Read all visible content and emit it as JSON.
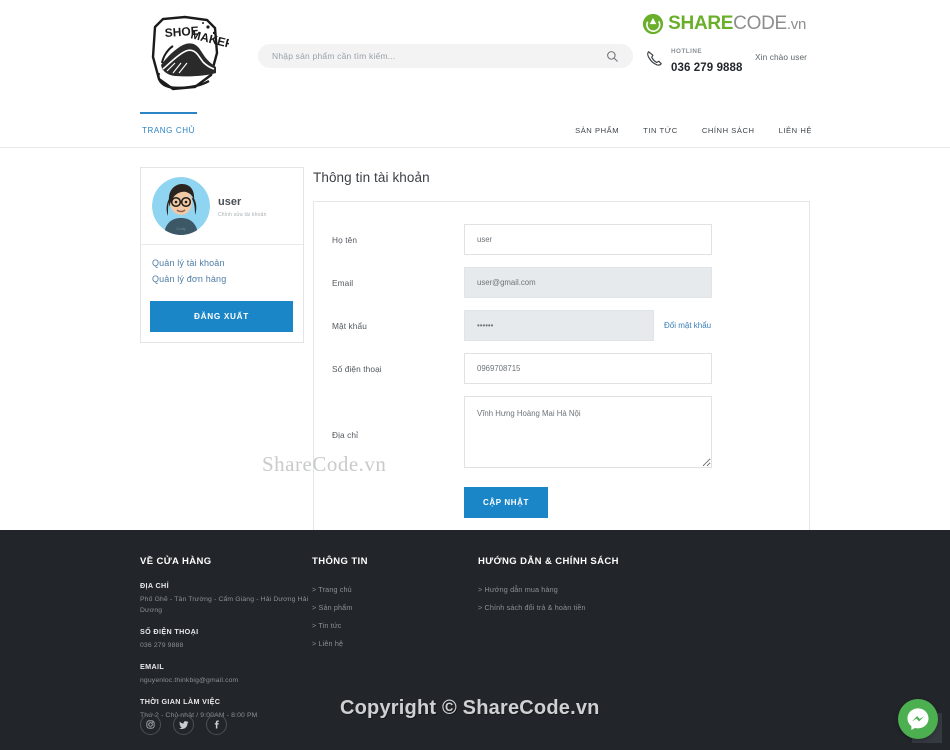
{
  "header": {
    "logo_alt": "Shoemaker",
    "search": {
      "placeholder": "Nhập sản phẩm cần tìm kiếm...",
      "value": ""
    },
    "hotline": {
      "label": "HOTLINE",
      "number": "036 279 9888"
    },
    "greeting": "Xin chào user",
    "sharecode_logo": {
      "share": "SHARE",
      "code": "CODE",
      "vn": ".vn"
    }
  },
  "nav": {
    "home": "TRANG CHỦ",
    "items": [
      {
        "label": "SẢN PHẨM"
      },
      {
        "label": "TIN TỨC"
      },
      {
        "label": "CHÍNH SÁCH"
      },
      {
        "label": "LIÊN HỆ"
      }
    ]
  },
  "sidebar": {
    "user_name": "user",
    "user_sub": "Chỉnh sửa tài khoản",
    "links": [
      {
        "label": "Quản lý tài khoản"
      },
      {
        "label": "Quản lý đơn hàng"
      }
    ],
    "logout_label": "ĐĂNG XUẤT"
  },
  "account": {
    "title": "Thông tin tài khoản",
    "fields": {
      "fullname": {
        "label": "Họ tên",
        "value": "user"
      },
      "email": {
        "label": "Email",
        "value": "user@gmail.com"
      },
      "password": {
        "label": "Mật khẩu",
        "value": "••••••",
        "change_link": "Đổi mật khẩu"
      },
      "phone": {
        "label": "Số điện thoại",
        "value": "0969708715"
      },
      "address": {
        "label": "Địa chỉ",
        "value": "Vĩnh Hưng Hoàng Mai Hà Nội"
      }
    },
    "submit_label": "CẬP NHẬT"
  },
  "footer": {
    "col1": {
      "title": "VỀ CỬA HÀNG",
      "address_head": "ĐỊA CHỈ",
      "address_text": "Phố Ghẽ - Tân Trường - Cẩm Giàng - Hải Dương Hải Dương",
      "phone_head": "SỐ ĐIỆN THOẠI",
      "phone_text": "036 279 9888",
      "email_head": "EMAIL",
      "email_text": "nguyenloc.thinkbig@gmail.com",
      "hours_head": "THỜI GIAN LÀM VIỆC",
      "hours_text": "Thứ 2 - Chủ nhật / 9:00AM - 8:00 PM"
    },
    "col2": {
      "title": "THÔNG TIN",
      "links": [
        {
          "label": "> Trang chủ"
        },
        {
          "label": "> Sản phẩm"
        },
        {
          "label": "> Tin tức"
        },
        {
          "label": "> Liên hệ"
        }
      ]
    },
    "col3": {
      "title": "HƯỚNG DẪN & CHÍNH SÁCH",
      "links": [
        {
          "label": "> Hướng dẫn mua hàng"
        },
        {
          "label": "> Chính sách đổi trả & hoàn tiền"
        }
      ]
    }
  },
  "watermarks": {
    "mid": "ShareCode.vn",
    "copyright": "Copyright © ShareCode.vn"
  },
  "colors": {
    "accent_blue": "#1a86c8",
    "link_blue": "#3a7fb8",
    "footer_bg": "#22262b",
    "messenger_green": "#4caf50",
    "sharecode_green": "#6aaf2a"
  }
}
